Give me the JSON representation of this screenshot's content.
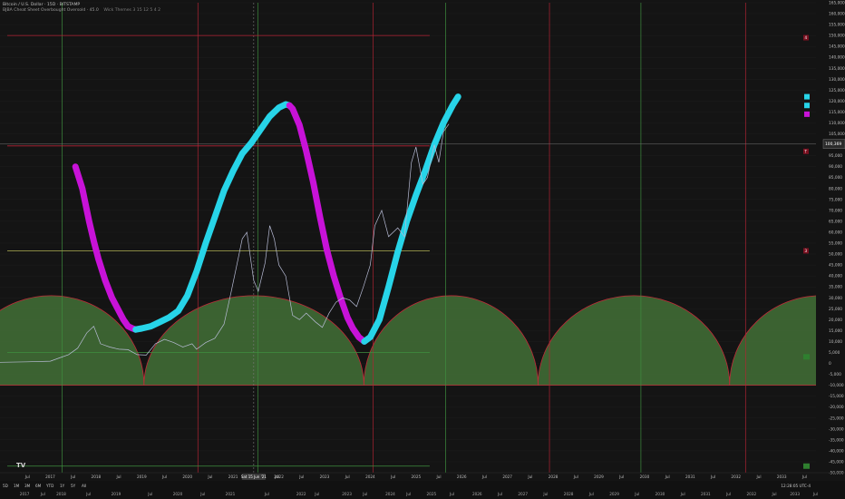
{
  "header": {
    "title": "Bitcoin / U.S. Dollar · 15D · BITSTAMP",
    "indicator": "BJBA Cheat Sheet Overbought Oversold · 45.0",
    "indicator_values": "Wick Themes  3  15  12  5  4  2"
  },
  "footer": {
    "timeframes": [
      "5D",
      "1M",
      "3M",
      "6M",
      "YTD",
      "1Y",
      "5Y",
      "All"
    ],
    "timezone": "12:28:05 UTC-4",
    "date_marker": "Sat 15 Jun '21"
  },
  "colors": {
    "background": "#141414",
    "price": "#b8bcd6",
    "uptrend": "#27d4e8",
    "downtrend": "#c812d8",
    "arch_fill": "#3f6934",
    "arch_edge": "#c02a38",
    "green_vline": "#3f8f3f",
    "red_hline": "#b32334",
    "yellow_hline": "#9a9a4a"
  },
  "chart_data": {
    "type": "line",
    "y_axis_ticks": [
      "165,000",
      "160,000",
      "155,000",
      "150,000",
      "145,000",
      "140,000",
      "135,000",
      "130,000",
      "125,000",
      "120,000",
      "115,000",
      "110,000",
      "105,000",
      "100,000",
      "95,000",
      "90,000",
      "85,000",
      "80,000",
      "75,000",
      "70,000",
      "65,000",
      "60,000",
      "55,000",
      "50,000",
      "45,000",
      "40,000",
      "35,000",
      "30,000",
      "25,000",
      "20,000",
      "15,000",
      "10,000",
      "5,000",
      "0",
      "-5,000",
      "-10,000",
      "-15,000",
      "-20,000",
      "-25,000",
      "-30,000",
      "-35,000",
      "-40,000",
      "-45,000",
      "-50,000"
    ],
    "ylim": [
      -50000,
      165000
    ],
    "last_price_label": "100,369",
    "x_axis_labels": [
      {
        "t": 2016.5,
        "label": "Jul"
      },
      {
        "t": 2017.0,
        "label": "2017"
      },
      {
        "t": 2017.5,
        "label": "Jul"
      },
      {
        "t": 2018.0,
        "label": "2018"
      },
      {
        "t": 2018.5,
        "label": "Jul"
      },
      {
        "t": 2019.0,
        "label": "2019"
      },
      {
        "t": 2019.5,
        "label": "Jul"
      },
      {
        "t": 2020.0,
        "label": "2020"
      },
      {
        "t": 2020.5,
        "label": "Jul"
      },
      {
        "t": 2021.0,
        "label": "2021"
      },
      {
        "t": 2021.96,
        "label": "Jul"
      },
      {
        "t": 2022.0,
        "label": "2022"
      },
      {
        "t": 2022.5,
        "label": "Jul"
      },
      {
        "t": 2023.0,
        "label": "2023"
      },
      {
        "t": 2023.5,
        "label": "Jul"
      },
      {
        "t": 2024.0,
        "label": "2024"
      },
      {
        "t": 2024.5,
        "label": "Jul"
      },
      {
        "t": 2025.0,
        "label": "2025"
      },
      {
        "t": 2025.5,
        "label": "Jul"
      },
      {
        "t": 2026.0,
        "label": "2026"
      },
      {
        "t": 2026.5,
        "label": "Jul"
      },
      {
        "t": 2027.0,
        "label": "2027"
      },
      {
        "t": 2027.5,
        "label": "Jul"
      },
      {
        "t": 2028.0,
        "label": "2028"
      },
      {
        "t": 2028.5,
        "label": "Jul"
      },
      {
        "t": 2029.0,
        "label": "2029"
      },
      {
        "t": 2029.5,
        "label": "Jul"
      },
      {
        "t": 2030.0,
        "label": "2030"
      },
      {
        "t": 2030.5,
        "label": "Jul"
      },
      {
        "t": 2031.0,
        "label": "2031"
      },
      {
        "t": 2031.5,
        "label": "Jul"
      },
      {
        "t": 2032.0,
        "label": "2032"
      },
      {
        "t": 2032.5,
        "label": "Jul"
      },
      {
        "t": 2033.0,
        "label": "2033"
      },
      {
        "t": 2033.5,
        "label": "Jul"
      }
    ],
    "x_axis_labels_bottom": [
      {
        "t": 2016.2,
        "label": "2017"
      },
      {
        "t": 2016.6,
        "label": "Jul"
      },
      {
        "t": 2017.0,
        "label": "2018"
      },
      {
        "t": 2017.6,
        "label": "Jul"
      },
      {
        "t": 2018.2,
        "label": "2019"
      },
      {
        "t": 2018.95,
        "label": "Jul"
      },
      {
        "t": 2019.55,
        "label": "2020"
      },
      {
        "t": 2020.1,
        "label": "Jul"
      },
      {
        "t": 2020.7,
        "label": "2021"
      },
      {
        "t": 2021.5,
        "label": "Jul"
      },
      {
        "t": 2022.25,
        "label": "2022"
      },
      {
        "t": 2022.6,
        "label": "Jul"
      },
      {
        "t": 2023.25,
        "label": "2023"
      },
      {
        "t": 2023.65,
        "label": "Jul"
      },
      {
        "t": 2024.2,
        "label": "2024"
      },
      {
        "t": 2024.6,
        "label": "Jul"
      },
      {
        "t": 2025.1,
        "label": "2025"
      },
      {
        "t": 2025.55,
        "label": "Jul"
      },
      {
        "t": 2026.1,
        "label": "2026"
      },
      {
        "t": 2026.6,
        "label": "Jul"
      },
      {
        "t": 2027.1,
        "label": "2027"
      },
      {
        "t": 2027.6,
        "label": "Jul"
      },
      {
        "t": 2028.1,
        "label": "2028"
      },
      {
        "t": 2028.6,
        "label": "Jul"
      },
      {
        "t": 2029.1,
        "label": "2029"
      },
      {
        "t": 2029.6,
        "label": "Jul"
      },
      {
        "t": 2030.1,
        "label": "2030"
      },
      {
        "t": 2030.6,
        "label": "Jul"
      },
      {
        "t": 2031.1,
        "label": "2031"
      },
      {
        "t": 2031.6,
        "label": "Jul"
      },
      {
        "t": 2032.1,
        "label": "2032"
      },
      {
        "t": 2032.6,
        "label": "Jul"
      },
      {
        "t": 2033.05,
        "label": "2033"
      },
      {
        "t": 2033.5,
        "label": "Jul"
      }
    ],
    "price_series": {
      "x": [
        2015.9,
        2016.5,
        2017.0,
        2017.2,
        2017.4,
        2017.6,
        2017.8,
        2017.95,
        2018.1,
        2018.3,
        2018.5,
        2018.7,
        2018.9,
        2019.1,
        2019.3,
        2019.5,
        2019.7,
        2019.9,
        2020.1,
        2020.2,
        2020.4,
        2020.6,
        2020.8,
        2020.95,
        2021.1,
        2021.2,
        2021.3,
        2021.45,
        2021.55,
        2021.7,
        2021.8,
        2021.9,
        2022.0,
        2022.15,
        2022.3,
        2022.45,
        2022.6,
        2022.8,
        2022.95,
        2023.1,
        2023.25,
        2023.4,
        2023.55,
        2023.7,
        2023.85,
        2024.0,
        2024.1,
        2024.25,
        2024.4,
        2024.6,
        2024.75,
        2024.9,
        2025.0,
        2025.15,
        2025.25,
        2025.4,
        2025.5,
        2025.6,
        2025.72
      ],
      "y": [
        500,
        700,
        1000,
        2500,
        4000,
        7000,
        14000,
        17000,
        9000,
        7500,
        6500,
        6300,
        4000,
        3800,
        9000,
        11000,
        9500,
        7500,
        9000,
        6500,
        9500,
        11500,
        18000,
        32000,
        47000,
        57000,
        60000,
        38000,
        33000,
        46000,
        63000,
        57000,
        45000,
        40000,
        22000,
        20000,
        23000,
        19000,
        16500,
        23000,
        28000,
        30000,
        29000,
        26000,
        35000,
        45000,
        63000,
        70000,
        58000,
        62000,
        58000,
        92000,
        99000,
        82000,
        85000,
        100000,
        92000,
        106000,
        109500
      ]
    },
    "oscillator_down_1": {
      "x": [
        2017.55,
        2017.7,
        2017.85,
        2017.95,
        2018.05,
        2018.2,
        2018.35,
        2018.5,
        2018.6,
        2018.7,
        2018.8,
        2018.87
      ],
      "y": [
        90000,
        80000,
        65000,
        56000,
        48000,
        38000,
        30000,
        24000,
        20000,
        17000,
        16000,
        15500
      ]
    },
    "oscillator_up_1": {
      "x": [
        2018.87,
        2019.0,
        2019.2,
        2019.4,
        2019.6,
        2019.8,
        2020.0,
        2020.2,
        2020.4,
        2020.6,
        2020.8,
        2021.0,
        2021.2,
        2021.4,
        2021.6,
        2021.8,
        2022.0,
        2022.15,
        2022.23
      ],
      "y": [
        15500,
        16000,
        17000,
        19000,
        21000,
        24000,
        31000,
        42000,
        55000,
        67000,
        79000,
        88000,
        96000,
        101000,
        107000,
        113000,
        117000,
        118500,
        118000
      ]
    },
    "oscillator_down_2": {
      "x": [
        2022.23,
        2022.3,
        2022.45,
        2022.6,
        2022.75,
        2022.9,
        2023.05,
        2023.2,
        2023.35,
        2023.5,
        2023.62,
        2023.75,
        2023.87
      ],
      "y": [
        118000,
        116500,
        109000,
        97000,
        83000,
        67000,
        52000,
        40000,
        30000,
        21000,
        16000,
        12000,
        10000
      ]
    },
    "oscillator_up_2": {
      "x": [
        2023.87,
        2024.0,
        2024.2,
        2024.4,
        2024.6,
        2024.8,
        2025.0,
        2025.2,
        2025.4,
        2025.6,
        2025.8,
        2025.92
      ],
      "y": [
        10000,
        12000,
        20000,
        35000,
        51000,
        65000,
        77000,
        88000,
        100000,
        110000,
        118000,
        122000
      ]
    },
    "cycle_arches": {
      "boundaries": [
        2014.99,
        2019.05,
        2023.86,
        2027.67,
        2031.86,
        2035.86
      ],
      "peak": 31000,
      "floor": -10000
    },
    "horizontal_levels": [
      {
        "value": 150000,
        "color_key": "red_hline"
      },
      {
        "value": 99500,
        "color_key": "red_hline"
      },
      {
        "value": 51500,
        "color_key": "yellow_hline"
      },
      {
        "value": 5000,
        "color_key": "green_vline"
      },
      {
        "value": -47000,
        "color_key": "green_vline"
      }
    ],
    "vertical_lines": [
      {
        "t": 2017.26,
        "color_key": "green_vline"
      },
      {
        "t": 2020.23,
        "color_key": "red_hline"
      },
      {
        "t": 2021.54,
        "color_key": "green_vline"
      },
      {
        "t": 2024.06,
        "color_key": "red_hline"
      },
      {
        "t": 2025.65,
        "color_key": "green_vline"
      },
      {
        "t": 2027.92,
        "color_key": "red_hline"
      },
      {
        "t": 2029.92,
        "color_key": "green_vline"
      },
      {
        "t": 2032.21,
        "color_key": "red_hline"
      }
    ],
    "badge_labels": [
      {
        "value": 149000,
        "text": "4"
      },
      {
        "value": 97000,
        "text": "T"
      },
      {
        "value": 51500,
        "text": "3"
      }
    ]
  }
}
